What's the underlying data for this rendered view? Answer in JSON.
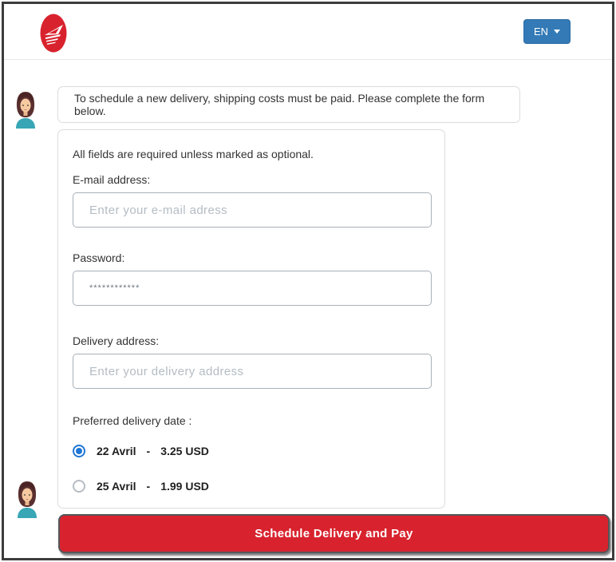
{
  "header": {
    "logo_name": "canada-post-logo",
    "language": {
      "label": "EN"
    }
  },
  "assistant": {
    "avatar_name": "woman-avatar",
    "message": "To schedule a new delivery, shipping costs must be paid. Please complete the form below."
  },
  "form": {
    "note": "All fields are required unless marked as optional.",
    "email": {
      "label": "E-mail address:",
      "placeholder": "Enter your e-mail adress",
      "value": ""
    },
    "password": {
      "label": "Password:",
      "value": "************"
    },
    "address": {
      "label": "Delivery address:",
      "placeholder": "Enter your delivery address",
      "value": ""
    },
    "delivery_date": {
      "label": "Preferred delivery date :",
      "options": [
        {
          "date": "22 Avril",
          "separator": "-",
          "price": "3.25 USD",
          "selected": true
        },
        {
          "date": "25 Avril",
          "separator": "-",
          "price": "1.99 USD",
          "selected": false
        }
      ]
    },
    "submit_label": "Schedule Delivery and Pay"
  },
  "colors": {
    "brand_red": "#d8232e",
    "language_button_blue": "#337ab7",
    "radio_selected_blue": "#1e76d6"
  }
}
